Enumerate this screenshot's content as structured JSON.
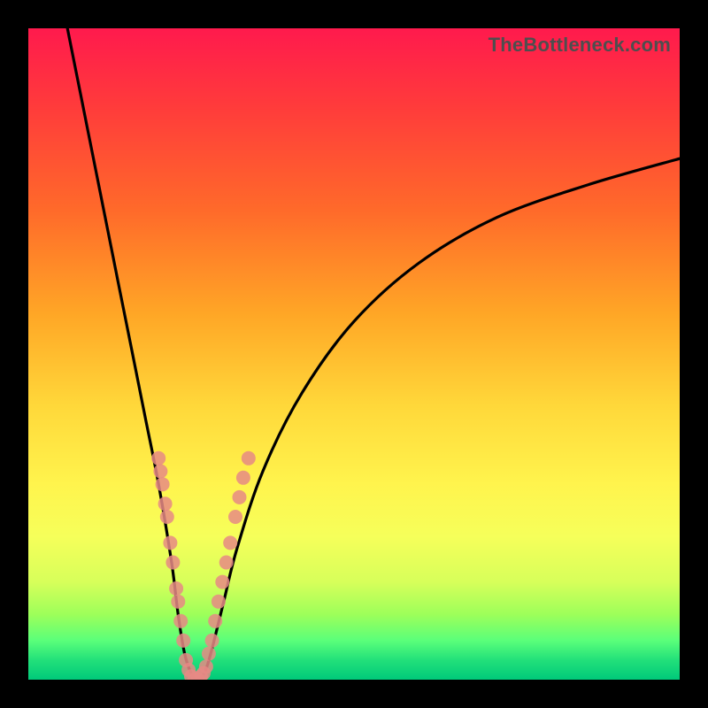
{
  "watermark": "TheBottleneck.com",
  "colors": {
    "frame_bg": "#000000",
    "curve": "#000000",
    "marker": "#e68a85",
    "gradient_stops": [
      "#ff1a4d",
      "#ff3b3b",
      "#ff6a2a",
      "#ffa726",
      "#ffd83a",
      "#fff44d",
      "#f6ff5a",
      "#d7ff5a",
      "#9dff5a",
      "#5aff7a",
      "#22e07a",
      "#00c97a"
    ]
  },
  "chart_data": {
    "type": "line",
    "title": "",
    "xlabel": "",
    "ylabel": "",
    "xlim": [
      0,
      100
    ],
    "ylim": [
      0,
      100
    ],
    "grid": false,
    "series": [
      {
        "name": "bottleneck-curve",
        "x": [
          6,
          8,
          10,
          12,
          14,
          16,
          18,
          20,
          22,
          23,
          24,
          25,
          26,
          27,
          28,
          30,
          32,
          36,
          42,
          50,
          60,
          72,
          86,
          100
        ],
        "y": [
          100,
          90,
          80,
          70,
          60,
          50,
          40,
          30,
          18,
          10,
          4,
          1,
          0,
          1,
          4,
          12,
          20,
          32,
          44,
          55,
          64,
          71,
          76,
          80
        ]
      }
    ],
    "markers": {
      "name": "highlighted-points",
      "color": "#e68a85",
      "points": [
        {
          "x": 20.0,
          "y": 34
        },
        {
          "x": 20.3,
          "y": 32
        },
        {
          "x": 20.6,
          "y": 30
        },
        {
          "x": 21.0,
          "y": 27
        },
        {
          "x": 21.3,
          "y": 25
        },
        {
          "x": 21.8,
          "y": 21
        },
        {
          "x": 22.2,
          "y": 18
        },
        {
          "x": 22.7,
          "y": 14
        },
        {
          "x": 23.0,
          "y": 12
        },
        {
          "x": 23.4,
          "y": 9
        },
        {
          "x": 23.8,
          "y": 6
        },
        {
          "x": 24.2,
          "y": 3
        },
        {
          "x": 24.6,
          "y": 1.5
        },
        {
          "x": 25.0,
          "y": 0.5
        },
        {
          "x": 25.5,
          "y": 0
        },
        {
          "x": 26.0,
          "y": 0
        },
        {
          "x": 26.5,
          "y": 0.5
        },
        {
          "x": 26.9,
          "y": 1
        },
        {
          "x": 27.3,
          "y": 2
        },
        {
          "x": 27.7,
          "y": 4
        },
        {
          "x": 28.2,
          "y": 6
        },
        {
          "x": 28.7,
          "y": 9
        },
        {
          "x": 29.2,
          "y": 12
        },
        {
          "x": 29.8,
          "y": 15
        },
        {
          "x": 30.4,
          "y": 18
        },
        {
          "x": 31.0,
          "y": 21
        },
        {
          "x": 31.8,
          "y": 25
        },
        {
          "x": 32.4,
          "y": 28
        },
        {
          "x": 33.0,
          "y": 31
        },
        {
          "x": 33.8,
          "y": 34
        }
      ]
    }
  }
}
